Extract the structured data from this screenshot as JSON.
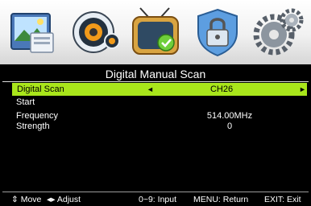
{
  "menu": {
    "title": "Digital Manual Scan",
    "icons": [
      "picture-icon",
      "sound-icon",
      "channel-tv-icon",
      "lock-icon",
      "setup-gear-icon"
    ]
  },
  "rows": {
    "scan": {
      "label": "Digital Scan",
      "value": "CH26",
      "left_arrow": "◄",
      "right_arrow": "►"
    },
    "start": {
      "label": "Start"
    },
    "frequency": {
      "label": "Frequency",
      "value": "514.00MHz"
    },
    "strength": {
      "label": "Strength",
      "value": "0"
    }
  },
  "footer": {
    "move": "⇕ Move",
    "adjust": "◂▸ Adjust",
    "input": "0~9: Input",
    "return": "MENU: Return",
    "exit": "EXIT: Exit"
  },
  "colors": {
    "highlight": "#a9e61b",
    "background": "#000000",
    "text": "#ffffff"
  }
}
